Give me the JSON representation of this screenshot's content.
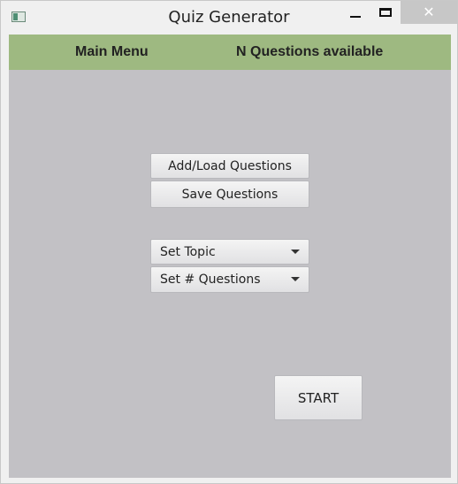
{
  "window": {
    "title": "Quiz Generator",
    "close_glyph": "✕"
  },
  "header": {
    "left_label": "Main Menu",
    "right_label": "N Questions available",
    "color": "#9eb981"
  },
  "main": {
    "add_load_label": "Add/Load Questions",
    "save_label": "Save Questions",
    "topic_select": "Set Topic",
    "num_questions_select": "Set # Questions",
    "start_label": "START",
    "background": "#c2c1c5"
  }
}
